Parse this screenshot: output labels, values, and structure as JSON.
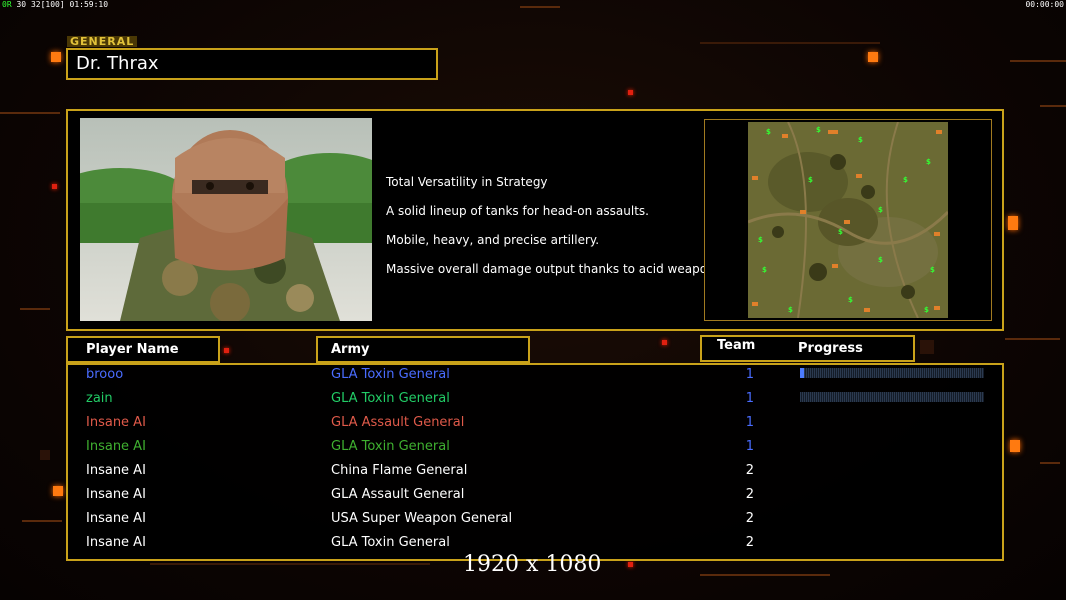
{
  "hud": {
    "left_prefix": "0R",
    "left_a": "30",
    "left_b": "32",
    "left_c": "[100]",
    "left_time": "01:59:10",
    "right_time": "00:00:00"
  },
  "general": {
    "label": "GENERAL",
    "name": "Dr. Thrax"
  },
  "description": [
    "Total Versatility in Strategy",
    "A solid lineup of tanks for head-on assaults.",
    "Mobile, heavy, and precise artillery.",
    "Massive overall damage output thanks to acid weapons."
  ],
  "map": {
    "start_positions": [
      "1",
      "2",
      "3",
      "4",
      "5",
      "6",
      "7",
      "8"
    ],
    "resource_symbol": "$"
  },
  "columns": {
    "player": "Player Name",
    "army": "Army",
    "team": "Team",
    "progress": "Progress"
  },
  "players": [
    {
      "name": "brooo",
      "army": "GLA Toxin General",
      "team": "1",
      "color": "#4a6cff",
      "progress": 0.02
    },
    {
      "name": "zain",
      "army": "GLA Toxin General",
      "team": "1",
      "color": "#22cc66",
      "progress": 0.0
    },
    {
      "name": "Insane AI",
      "army": "GLA Assault General",
      "team": "1",
      "color": "#e05a4a"
    },
    {
      "name": "Insane AI",
      "army": "GLA Toxin General",
      "team": "1",
      "color": "#3fb030"
    },
    {
      "name": "Insane AI",
      "army": "China Flame General",
      "team": "2",
      "color": "#ffffff"
    },
    {
      "name": "Insane AI",
      "army": "GLA Assault General",
      "team": "2",
      "color": "#ffffff"
    },
    {
      "name": "Insane AI",
      "army": "USA Super Weapon General",
      "team": "2",
      "color": "#ffffff"
    },
    {
      "name": "Insane AI",
      "army": "GLA Toxin General",
      "team": "2",
      "color": "#ffffff"
    }
  ],
  "team_color": "#4a6cff",
  "resolution_watermark": "1920 x 1080"
}
